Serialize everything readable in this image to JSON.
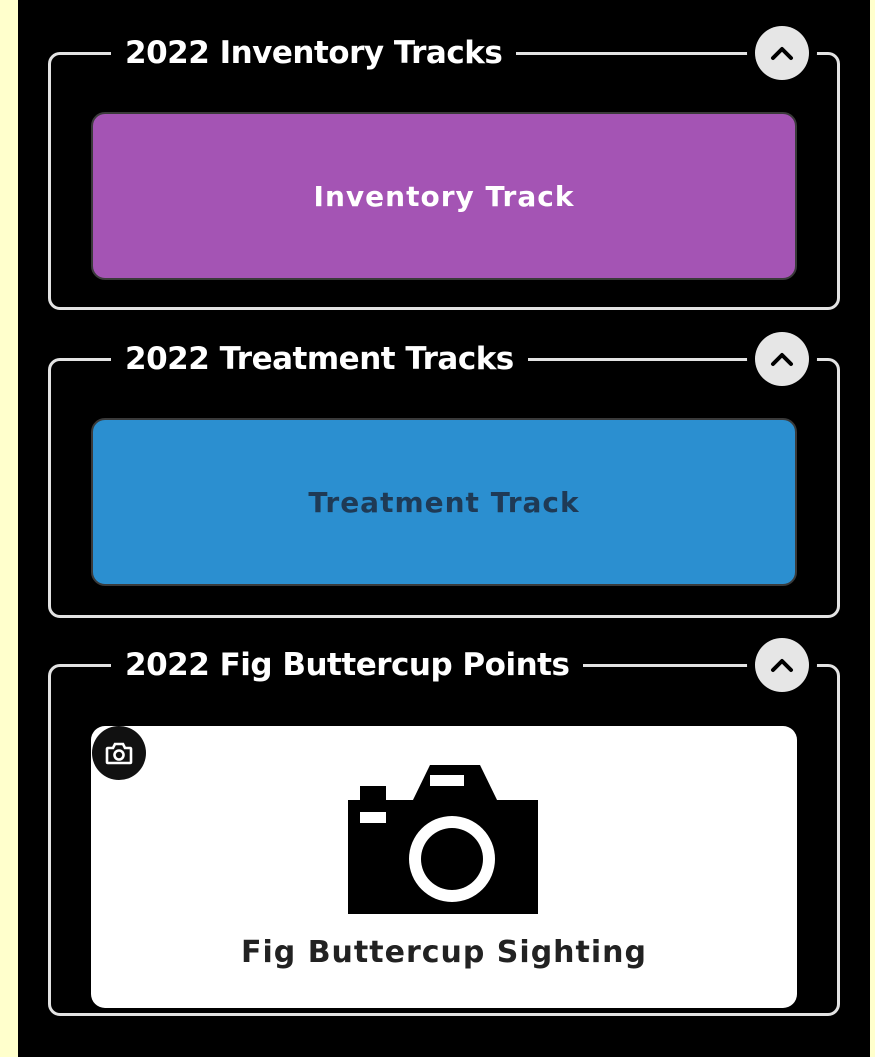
{
  "sections": [
    {
      "title": "2022 Inventory Tracks",
      "button_label": "Inventory Track",
      "button_color": "#a454b4",
      "text_color": "#ffffff"
    },
    {
      "title": "2022 Treatment Tracks",
      "button_label": "Treatment Track",
      "button_color": "#2b8fd0",
      "text_color": "#1f3a55"
    },
    {
      "title": "2022 Fig Buttercup Points",
      "card_label": "Fig Buttercup Sighting",
      "card_color": "#ffffff",
      "icon": "camera-icon",
      "badge_icon": "camera-icon"
    }
  ],
  "colors": {
    "page_background": "#ffffcc",
    "panel_background": "#000000",
    "border": "#e3e3e3",
    "collapse_button": "#e6e6e6"
  }
}
